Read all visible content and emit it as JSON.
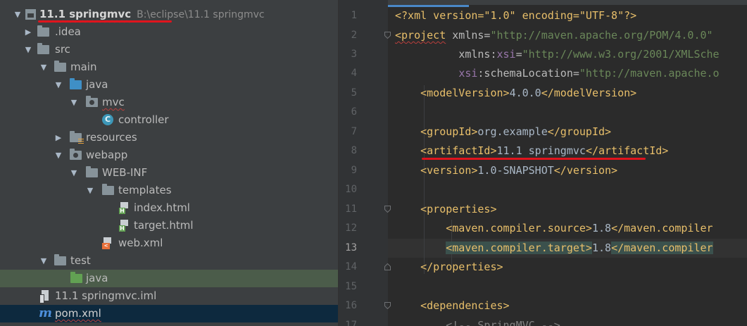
{
  "project_tree": {
    "root": {
      "name": "11.1 springmvc",
      "path": "B:\\eclipse\\11.1 springmvc"
    },
    "items": [
      {
        "label": ".idea"
      },
      {
        "label": "src"
      },
      {
        "label": "main"
      },
      {
        "label": "java"
      },
      {
        "label": "mvc"
      },
      {
        "label": "controller",
        "icon_letter": "C"
      },
      {
        "label": "resources"
      },
      {
        "label": "webapp"
      },
      {
        "label": "WEB-INF"
      },
      {
        "label": "templates"
      },
      {
        "label": "index.html",
        "icon_letter": "H"
      },
      {
        "label": "target.html",
        "icon_letter": "H"
      },
      {
        "label": "web.xml",
        "icon_letter": "<"
      },
      {
        "label": "test"
      },
      {
        "label": "java"
      },
      {
        "label": "11.1 springmvc.iml"
      },
      {
        "label": "pom.xml",
        "icon_letter": "m"
      }
    ]
  },
  "editor": {
    "current_line": 13,
    "lines": [
      {
        "num": "1",
        "parts": [
          "<?xml version=\"1.0\" encoding=\"UTF-8\"?>"
        ]
      },
      {
        "num": "2",
        "parts": [
          "<project",
          " xmlns=",
          "\"http://maven.apache.org/POM/4.0.0\""
        ]
      },
      {
        "num": "3",
        "parts": [
          "xmlns:",
          "xsi",
          "=",
          "\"http://www.w3.org/2001/XMLSche"
        ]
      },
      {
        "num": "4",
        "parts": [
          "xsi",
          ":schemaLocation=",
          "\"http://maven.apache.o"
        ]
      },
      {
        "num": "5",
        "parts": [
          "<modelVersion>",
          "4.0.0",
          "</modelVersion>"
        ]
      },
      {
        "num": "6",
        "parts": []
      },
      {
        "num": "7",
        "parts": [
          "<groupId>",
          "org.example",
          "</groupId>"
        ]
      },
      {
        "num": "8",
        "parts": [
          "<artifactId>",
          "11.1 springmvc",
          "</artifactId>"
        ]
      },
      {
        "num": "9",
        "parts": [
          "<version>",
          "1.0-SNAPSHOT",
          "</version>"
        ]
      },
      {
        "num": "10",
        "parts": []
      },
      {
        "num": "11",
        "parts": [
          "<properties>"
        ]
      },
      {
        "num": "12",
        "parts": [
          "<maven.compiler.source>",
          "1.8",
          "</maven.compiler"
        ]
      },
      {
        "num": "13",
        "parts": [
          "<maven.compiler.target>",
          "1.8",
          "</maven.compiler"
        ]
      },
      {
        "num": "14",
        "parts": [
          "</properties>"
        ]
      },
      {
        "num": "15",
        "parts": []
      },
      {
        "num": "16",
        "parts": [
          "<dependencies>"
        ]
      },
      {
        "num": "17",
        "parts": [
          "<!-- SpringMVC -->"
        ]
      }
    ]
  },
  "colors": {
    "tag": "#e8bf6a",
    "attr_value": "#6a8759",
    "namespace": "#9876aa",
    "annotation_underline": "#e0141d",
    "selection_green": "#4b5c4a",
    "selection_blue": "#0d293e"
  }
}
